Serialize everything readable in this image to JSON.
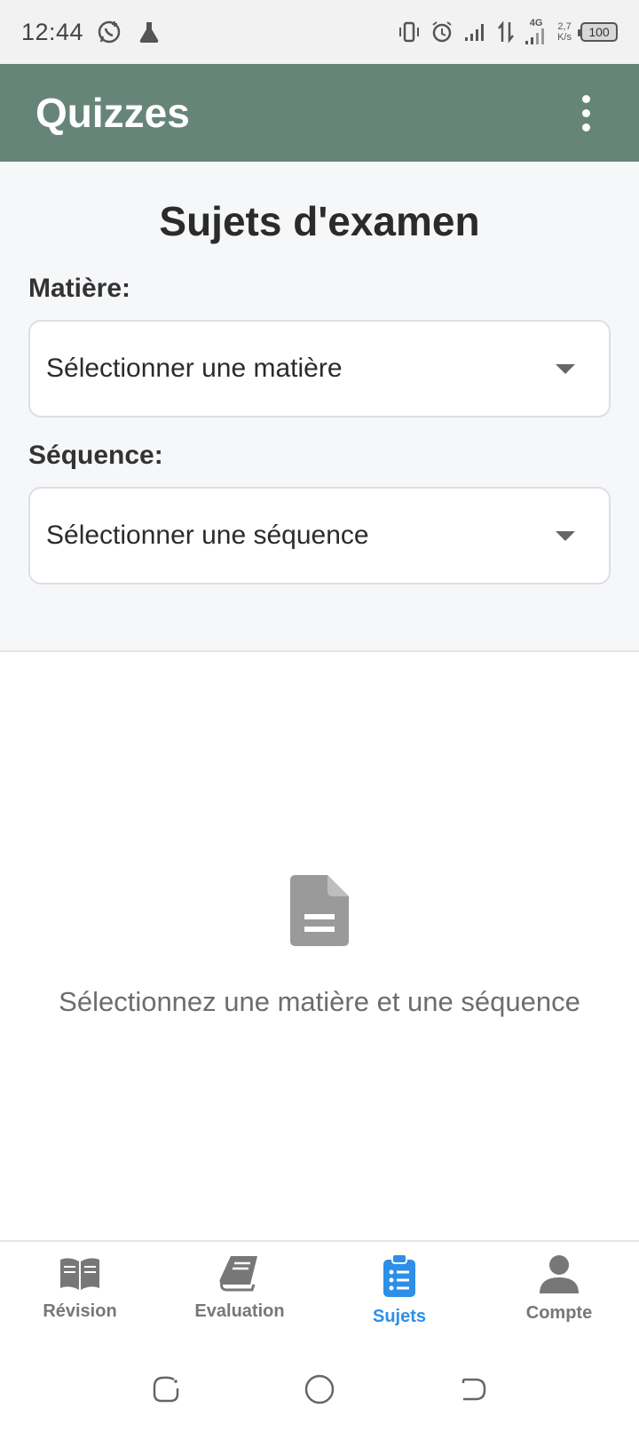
{
  "status_bar": {
    "time": "12:44",
    "network": "4G",
    "speed_value": "2,7",
    "speed_unit": "K/s",
    "battery": "100",
    "icons": [
      "whatsapp-icon",
      "flask-icon",
      "vibrate-icon",
      "alarm-icon",
      "signal-icon",
      "data-arrows-icon",
      "signal-4g-icon",
      "battery-icon"
    ]
  },
  "app_bar": {
    "title": "Quizzes",
    "menu_icon": "more-vertical-icon",
    "color": "#668578"
  },
  "filters": {
    "title": "Sujets d'examen",
    "subject_label": "Matière:",
    "subject_placeholder": "Sélectionner une matière",
    "sequence_label": "Séquence:",
    "sequence_placeholder": "Sélectionner une séquence"
  },
  "empty_state": {
    "icon": "document-icon",
    "message": "Sélectionnez une matière et une séquence"
  },
  "bottom_nav": {
    "items": [
      {
        "label": "Révision",
        "icon": "open-book-icon",
        "active": false
      },
      {
        "label": "Evaluation",
        "icon": "book-icon",
        "active": false
      },
      {
        "label": "Sujets",
        "icon": "clipboard-list-icon",
        "active": true
      },
      {
        "label": "Compte",
        "icon": "user-icon",
        "active": false
      }
    ],
    "active_color": "#2d8fe8",
    "inactive_color": "#777777"
  },
  "system_nav": {
    "icons": [
      "recent-apps-icon",
      "home-icon",
      "back-icon"
    ]
  }
}
